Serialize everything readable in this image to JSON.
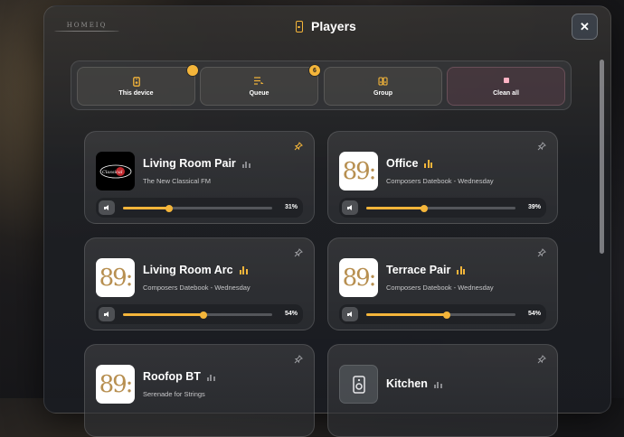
{
  "header": {
    "logo_text": "HOMEIQ",
    "title": "Players",
    "close_label": "✕"
  },
  "toolbar": {
    "buttons": [
      {
        "label": "This device",
        "icon": "speaker-icon",
        "badge": ""
      },
      {
        "label": "Queue",
        "icon": "queue-icon",
        "badge": "6"
      },
      {
        "label": "Group",
        "icon": "group-icon",
        "badge": ""
      },
      {
        "label": "Clean all",
        "icon": "stop-icon",
        "badge": ""
      }
    ]
  },
  "players": [
    {
      "name": "Living Room Pair",
      "subtitle": "The New Classical FM",
      "volume_label": "31%",
      "volume": 31,
      "playing": false,
      "pinned": true,
      "art": "classical-fm-logo"
    },
    {
      "name": "Office",
      "subtitle": "Composers Datebook - Wednesday",
      "volume_label": "39%",
      "volume": 39,
      "playing": true,
      "pinned": false,
      "art": "89"
    },
    {
      "name": "Living Room Arc",
      "subtitle": "Composers Datebook - Wednesday",
      "volume_label": "54%",
      "volume": 54,
      "playing": true,
      "pinned": false,
      "art": "89"
    },
    {
      "name": "Terrace Pair",
      "subtitle": "Composers Datebook - Wednesday",
      "volume_label": "54%",
      "volume": 54,
      "playing": true,
      "pinned": false,
      "art": "89"
    },
    {
      "name": "Roofop BT",
      "subtitle": "Serenade for Strings",
      "playing": false,
      "pinned": false,
      "art": "89"
    },
    {
      "name": "Kitchen",
      "subtitle": "",
      "playing": false,
      "pinned": false,
      "art": "speaker-icon"
    }
  ],
  "art_text": "89:",
  "colors": {
    "accent": "#f4b53a",
    "art_gold": "#b78f50"
  }
}
